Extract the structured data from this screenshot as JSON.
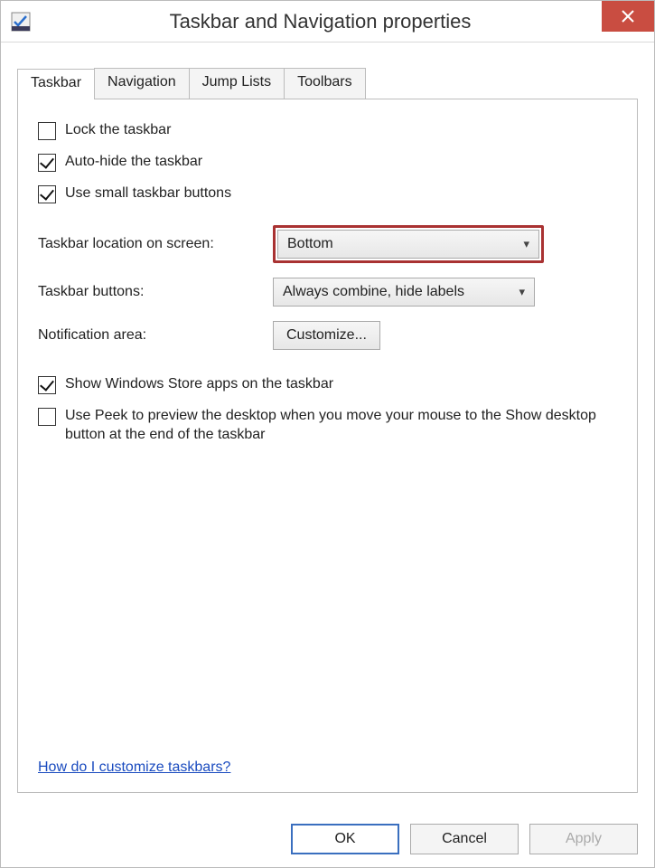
{
  "window": {
    "title": "Taskbar and Navigation properties"
  },
  "tabs": {
    "t1": "Taskbar",
    "t2": "Navigation",
    "t3": "Jump Lists",
    "t4": "Toolbars"
  },
  "checks": {
    "lock": "Lock the taskbar",
    "autohide": "Auto-hide the taskbar",
    "small": "Use small taskbar buttons",
    "store": "Show Windows Store apps on the taskbar",
    "peek": "Use Peek to preview the desktop when you move your mouse to the Show desktop button at the end of the taskbar"
  },
  "labels": {
    "location": "Taskbar location on screen:",
    "buttons": "Taskbar buttons:",
    "notif": "Notification area:"
  },
  "values": {
    "location": "Bottom",
    "buttons": "Always combine, hide labels",
    "customize": "Customize..."
  },
  "help": "How do I customize taskbars?",
  "dlg": {
    "ok": "OK",
    "cancel": "Cancel",
    "apply": "Apply"
  }
}
